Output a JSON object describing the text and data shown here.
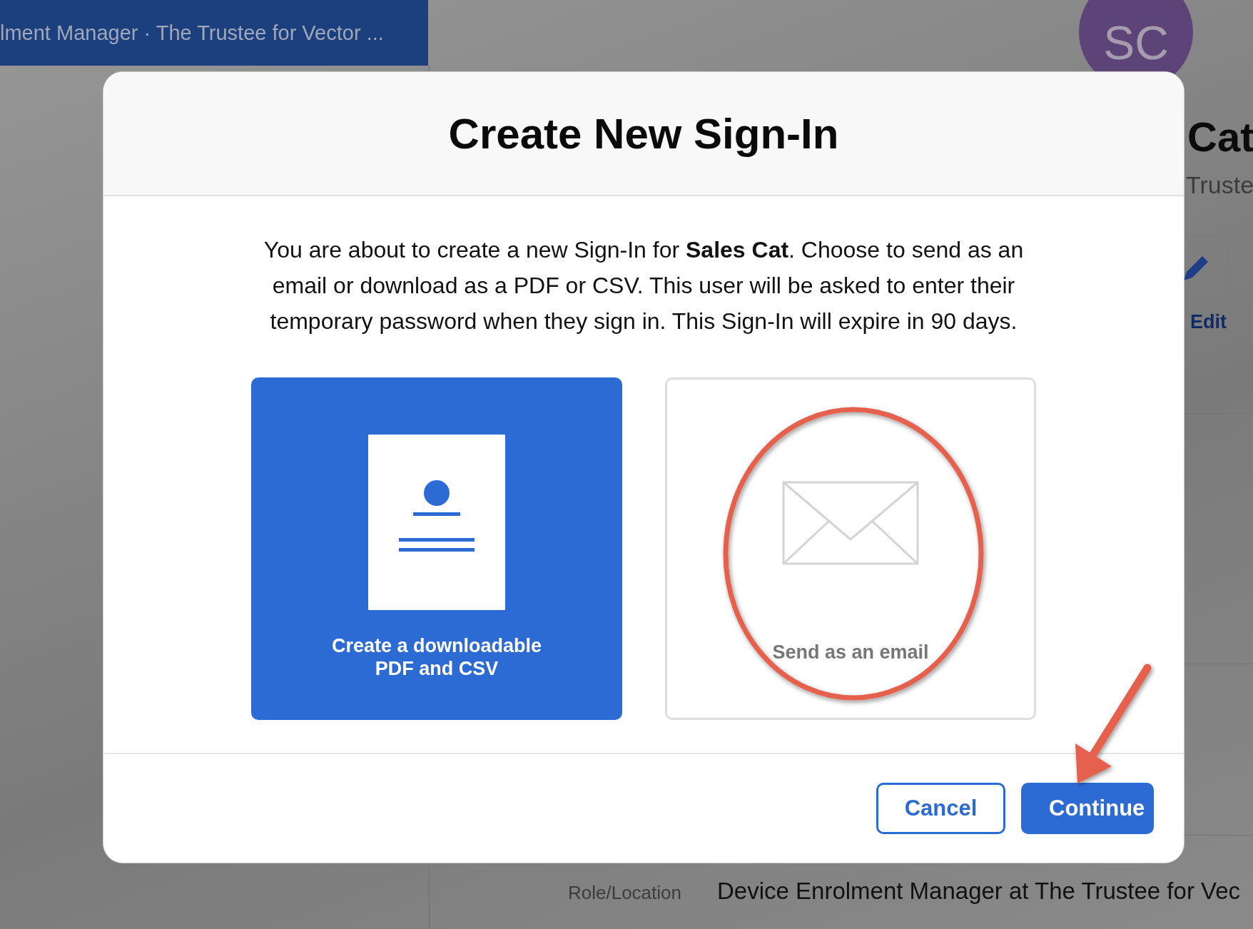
{
  "background": {
    "header_title": "lment Manager · The Trustee for Vector ...",
    "avatar_initials": "SC",
    "heading": "Cat",
    "subheading": "Truste",
    "edit_label": "Edit",
    "detail_label": "Role/Location",
    "detail_value": "Device Enrolment Manager at The Trustee for Vec"
  },
  "dialog": {
    "title": "Create New Sign-In",
    "message": "You are about to create a new Sign-In for **Sales Cat**. Choose to send as an email or download as a PDF or CSV. This user will be asked to enter their temporary password when they sign in. This Sign-In will expire in 90 days.",
    "options": [
      {
        "kind": "download",
        "label": "Create a downloadable PDF and CSV",
        "selected": true
      },
      {
        "kind": "email",
        "label": "Send as an email",
        "selected": false
      }
    ],
    "buttons": [
      {
        "kind": "secondary",
        "label": "Cancel"
      },
      {
        "kind": "primary",
        "label": "Continue"
      }
    ]
  }
}
